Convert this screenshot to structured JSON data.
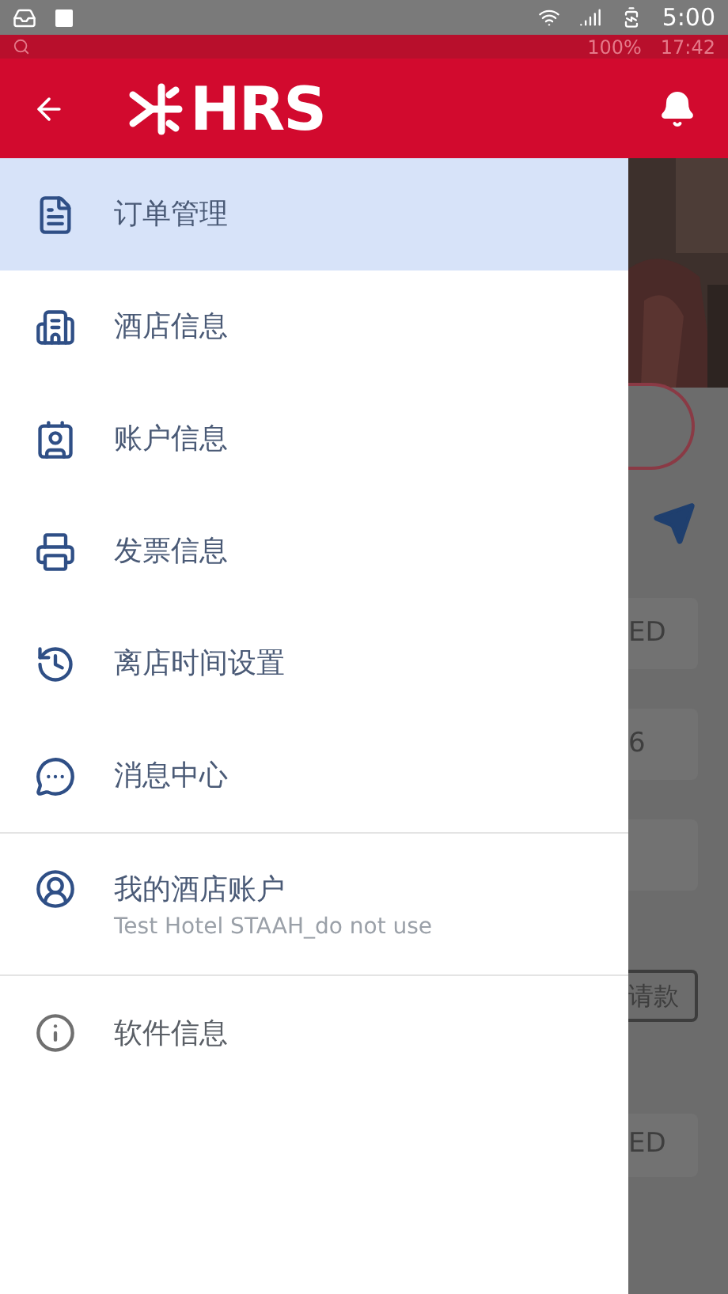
{
  "status_bar": {
    "time": "5:00"
  },
  "app_status_bar": {
    "battery": "100%",
    "time": "17:42"
  },
  "header": {
    "logo": "HRS"
  },
  "drawer": {
    "items": [
      {
        "label": "订单管理",
        "selected": true
      },
      {
        "label": "酒店信息",
        "selected": false
      },
      {
        "label": "账户信息",
        "selected": false
      },
      {
        "label": "发票信息",
        "selected": false
      },
      {
        "label": "离店时间设置",
        "selected": false
      },
      {
        "label": "消息中心",
        "selected": false
      }
    ],
    "account": {
      "title": "我的酒店账户",
      "subtitle": "Test Hotel STAAH_do not use"
    },
    "about": {
      "label": "软件信息"
    }
  },
  "background": {
    "fields": [
      "ED",
      "6"
    ],
    "button": "请款",
    "last_field": "ED"
  }
}
